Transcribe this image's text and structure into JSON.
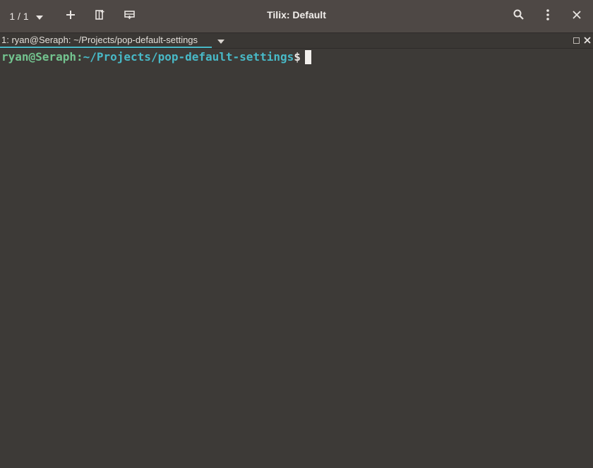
{
  "headerbar": {
    "session_count": "1 / 1",
    "title": "Tilix: Default"
  },
  "tab": {
    "label": "1: ryan@Seraph: ~/Projects/pop-default-settings"
  },
  "terminal": {
    "user_host": "ryan@Seraph",
    "separator": ":",
    "path": "~/Projects/pop-default-settings",
    "prompt_symbol": "$"
  },
  "colors": {
    "headerbar_bg": "#4e4845",
    "terminal_bg": "#3d3a37",
    "accent": "#48b9c7",
    "prompt_user": "#73c48f"
  },
  "icons": {
    "session_menu": "chevron-down-icon",
    "add_session": "plus-icon",
    "add_terminal_right": "split-right-icon",
    "add_terminal_down": "split-down-icon",
    "find": "search-icon",
    "menu": "kebab-menu-icon",
    "close": "close-icon"
  }
}
